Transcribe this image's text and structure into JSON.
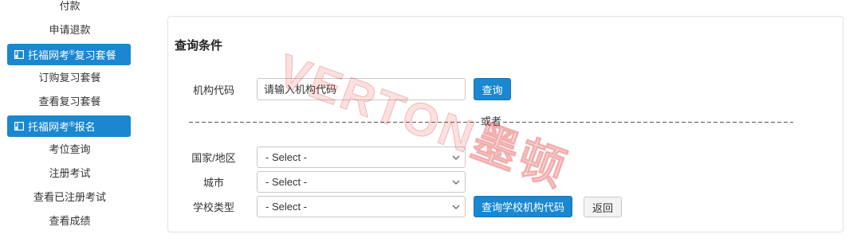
{
  "theme": {
    "primary": "#1a87d0",
    "panel_border": "#e2e2e2",
    "text": "#333333"
  },
  "sidebar": {
    "account_items": [
      {
        "label": "付款"
      },
      {
        "label": "申请退款"
      }
    ],
    "sections": [
      {
        "icon": "book-icon",
        "title_pre": "托福网考",
        "title_mark": "®",
        "title_post": "复习套餐",
        "items": [
          {
            "label": "订购复习套餐"
          },
          {
            "label": "查看复习套餐"
          }
        ]
      },
      {
        "icon": "book-icon",
        "title_pre": "托福网考",
        "title_mark": "®",
        "title_post": "报名",
        "items": [
          {
            "label": "考位查询"
          },
          {
            "label": "注册考试"
          },
          {
            "label": "查看已注册考试"
          },
          {
            "label": "查看成绩"
          }
        ]
      }
    ]
  },
  "query_panel": {
    "title": "查询条件",
    "institution_code": {
      "label": "机构代码",
      "placeholder": "请输入机构代码",
      "button": "查询"
    },
    "divider_text": "或者",
    "select_icon": "chevron-down-icon",
    "filters": [
      {
        "label": "国家/地区",
        "selected": "- Select -"
      },
      {
        "label": "城市",
        "selected": "- Select -"
      },
      {
        "label": "学校类型",
        "selected": "- Select -"
      }
    ],
    "search_button": "查询学校机构代码",
    "back_button": "返回"
  },
  "watermark": {
    "text": "VERTON墨顿"
  }
}
